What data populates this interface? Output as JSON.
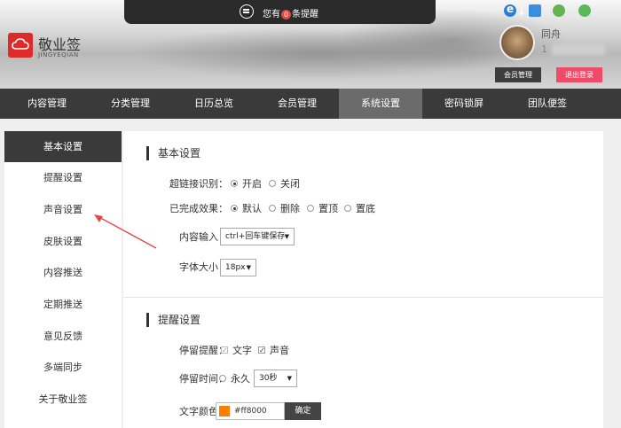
{
  "header": {
    "notice_prefix": "您有",
    "notice_count": "0",
    "notice_suffix": "条提醒",
    "logo_name": "敬业签",
    "logo_sub": "JINGYEQIAN",
    "user_name": "同舟",
    "user_id": "1",
    "member_btn": "会员管理",
    "logout_btn": "退出登录",
    "platform_icons": [
      "ie-icon",
      "windows-icon",
      "apple-icon",
      "android-icon"
    ]
  },
  "nav": [
    "内容管理",
    "分类管理",
    "日历总览",
    "会员管理",
    "系统设置",
    "密码锁屏",
    "团队便签"
  ],
  "nav_active": "系统设置",
  "sidebar": [
    "基本设置",
    "提醒设置",
    "声音设置",
    "皮肤设置",
    "内容推送",
    "定期推送",
    "意见反馈",
    "多端同步",
    "关于敬业签"
  ],
  "sidebar_active": "基本设置",
  "basic": {
    "title": "基本设置",
    "link_label": "超链接识别：",
    "link_on": "开启",
    "link_off": "关闭",
    "done_label": "已完成效果：",
    "done_opts": [
      "默认",
      "删除",
      "置顶",
      "置底"
    ],
    "input_label": "内容输入：",
    "input_value": "ctrl+回车键保存",
    "font_label": "字体大小：",
    "font_value": "18px"
  },
  "remind": {
    "title": "提醒设置",
    "stay_label": "停留提醒：",
    "stay_text": "文字",
    "stay_sound": "声音",
    "time_label": "停留时间：",
    "time_forever": "永久",
    "time_value": "30秒",
    "color_label": "文字颜色：",
    "color_value": "#ff8000",
    "ok_btn": "确定"
  },
  "colors": {
    "accent": "#ff8000",
    "logout": "#ef4a67",
    "logo": "#e02a2a",
    "nav_bg": "#3a3a3a"
  }
}
